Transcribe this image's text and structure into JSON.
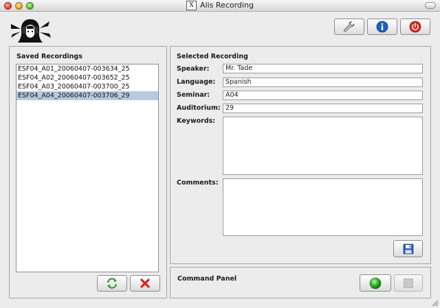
{
  "window": {
    "title": "Alis Recording",
    "x_badge": "X"
  },
  "toolbar": {
    "settings_icon": "wrench-icon",
    "info_icon": "info-icon",
    "quit_icon": "power-icon"
  },
  "saved_recordings": {
    "title": "Saved Recordings",
    "items": [
      {
        "label": "ESF04_A01_20060407-003634_25",
        "selected": false
      },
      {
        "label": "ESF04_A02_20060407-003652_25",
        "selected": false
      },
      {
        "label": "ESF04_A03_20060407-003700_25",
        "selected": false
      },
      {
        "label": "ESF04_A04_20060407-003706_29",
        "selected": true
      }
    ],
    "refresh_icon": "refresh-icon",
    "delete_icon": "delete-icon"
  },
  "selected_recording": {
    "title": "Selected Recording",
    "speaker": {
      "label": "Speaker:",
      "value": "Mr. Tade"
    },
    "language": {
      "label": "Language:",
      "value": "Spanish"
    },
    "seminar": {
      "label": "Seminar:",
      "value": "A04"
    },
    "auditorium": {
      "label": "Auditorium:",
      "value": "29"
    },
    "keywords": {
      "label": "Keywords:",
      "value": ""
    },
    "comments": {
      "label": "Comments:",
      "value": ""
    },
    "save_icon": "floppy-disk-icon"
  },
  "command_panel": {
    "title": "Command Panel",
    "record_icon": "record-green-icon",
    "stop_icon": "stop-icon"
  },
  "colors": {
    "selection": "#b7c9e0",
    "record_green": "#2fb52a",
    "power_red": "#d8261f",
    "info_blue": "#1f5fc2"
  }
}
